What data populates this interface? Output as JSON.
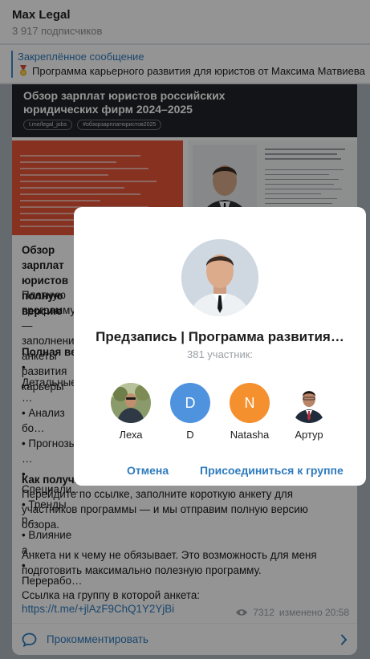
{
  "header": {
    "title": "Max Legal",
    "subscribers": "3 917 подписчиков"
  },
  "pinned": {
    "title": "Закреплённое сообщение",
    "text": "Программа карьерного развития для юристов от Максима Матвиева"
  },
  "post": {
    "banner_title": "Обзор зарплат юристов российских юридических фирм 2024–2025",
    "banner_chips": [
      "t.me/legal_jobs",
      "#обзорзарплатюристов2025"
    ],
    "heading": "Обзор зарплат юристов полную версию",
    "para1": "Платную программу — заполнение анкеты развития карьеры",
    "list_heading": "Полная версия",
    "list_items": [
      "• Детальные …",
      "• Анализ бо…",
      "• Прогнозы …",
      "• Специали…",
      "• Тренды р…",
      "• Влияние а…",
      "• Перерабо…"
    ],
    "how_heading": "Как получить",
    "how_text": "Перейдите по ссылке, заполните короткую анкету для участников программы — и мы отправим полную версию обзора.",
    "note": "Анкета ни к чему не обязывает. Это возможность для меня подготовить максимально полезную программу.",
    "link_label": "Ссылка на группу в которой анкета:",
    "link": "https://t.me/+jlAzF9ChQ1Y2YjBi",
    "views": "7312",
    "edited": "изменено 20:58",
    "comment": "Прокомментировать"
  },
  "modal": {
    "title": "Предзапись | Программа развития…",
    "count": "381 участник:",
    "members": [
      {
        "name": "Леха",
        "letter": "",
        "color": ""
      },
      {
        "name": "D",
        "letter": "D",
        "color": "#4f93df"
      },
      {
        "name": "Natasha",
        "letter": "N",
        "color": "#f5902f"
      },
      {
        "name": "Артур",
        "letter": "",
        "color": ""
      }
    ],
    "cancel": "Отмена",
    "join": "Присоединиться к группе"
  }
}
